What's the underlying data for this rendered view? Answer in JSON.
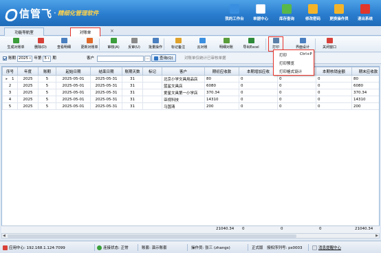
{
  "app": {
    "brand": "信管飞",
    "subtitle": "精细化管理软件",
    "separator": "·"
  },
  "topnav": [
    {
      "label": "我的工作台",
      "icon": "monitor-icon",
      "color": "#3b8fe0"
    },
    {
      "label": "单据中心",
      "icon": "document-list-icon",
      "color": "#ffffff"
    },
    {
      "label": "库存查询",
      "icon": "box-icon",
      "color": "#59b84a"
    },
    {
      "label": "修改密码",
      "icon": "key-icon",
      "color": "#f4b42a"
    },
    {
      "label": "更换操作员",
      "icon": "user-icon",
      "color": "#f4b42a"
    },
    {
      "label": "退出系统",
      "icon": "power-icon",
      "color": "#e0362c"
    }
  ],
  "tabs": {
    "nav": "功能导航室",
    "active": "对账单",
    "close": "×"
  },
  "toolbar": [
    {
      "label": "生成对账单",
      "icon": "generate-icon",
      "color": "#3b9d3b"
    },
    {
      "label": "删除(D)",
      "icon": "delete-icon",
      "color": "#d8413a"
    },
    {
      "label": "查看明细",
      "icon": "detail-icon",
      "color": "#4a7fc0"
    },
    {
      "label": "更新对账单",
      "icon": "refresh-icon",
      "color": "#e06a2a"
    },
    {
      "label": "审核(A)",
      "icon": "approve-icon",
      "color": "#3b9d3b"
    },
    {
      "label": "反审(U)",
      "icon": "unapprove-icon",
      "color": "#8a8a8a"
    },
    {
      "label": "批量操作",
      "icon": "batch-icon",
      "color": "#4a7fc0"
    },
    {
      "label": "标记备注",
      "icon": "mark-icon",
      "color": "#e0a22a"
    },
    {
      "label": "云对账",
      "icon": "cloud-icon",
      "color": "#3b8fe0"
    },
    {
      "label": "明细对账",
      "icon": "reconcile-icon",
      "color": "#5a9d3b"
    },
    {
      "label": "导出Excel",
      "icon": "excel-icon",
      "color": "#2e8b3a"
    },
    {
      "label": "打印",
      "icon": "printer-icon",
      "color": "#5a7fa8"
    },
    {
      "label": "界面设计",
      "icon": "design-icon",
      "color": "#4a7fc0"
    },
    {
      "label": "关闭窗口",
      "icon": "close-window-icon",
      "color": "#d8413a"
    }
  ],
  "filter": {
    "period_label": "账期",
    "year": "2025",
    "year_label": "年第",
    "period": "5",
    "period_suffix": "期",
    "customer_label": "客户",
    "customer_value": "",
    "query_label": "查询(Q)",
    "hint": "对账单仅统计已审核单据",
    "ellipsis": "..."
  },
  "table": {
    "columns": [
      "序号",
      "年度",
      "账期",
      "起始日期",
      "结束日期",
      "账期天数",
      "标记",
      "客户",
      "期初应收款",
      "本期增加应收",
      "本期减少应收",
      "本期核销金额",
      "期末应收款"
    ],
    "rows": [
      [
        "1",
        "2025",
        "5",
        "2025-05-01",
        "2025-05-31",
        "31",
        "",
        "北京小学文具用品店",
        "80",
        "0",
        "0",
        "0",
        "80"
      ],
      [
        "2",
        "2025",
        "5",
        "2025-05-01",
        "2025-05-31",
        "31",
        "",
        "蓝鲨文具店",
        "6080",
        "0",
        "0",
        "0",
        "6080"
      ],
      [
        "3",
        "2025",
        "5",
        "2025-05-01",
        "2025-05-31",
        "31",
        "",
        "爱星文具第一小学店",
        "370.34",
        "0",
        "0",
        "0",
        "370.34"
      ],
      [
        "4",
        "2025",
        "5",
        "2025-05-01",
        "2025-05-31",
        "31",
        "",
        "亚视科技",
        "14310",
        "0",
        "0",
        "0",
        "14310"
      ],
      [
        "5",
        "2025",
        "5",
        "2025-05-01",
        "2025-05-31",
        "31",
        "",
        "马国清",
        "200",
        "0",
        "0",
        "0",
        "200"
      ]
    ],
    "totals": {
      "opening": "21040.34",
      "increase": "0",
      "decrease": "0",
      "writeoff": "0",
      "closing": "21040.34"
    },
    "row_marker": "▸"
  },
  "print_menu": [
    {
      "label": "打印",
      "shortcut": "Ctrl+P"
    },
    {
      "label": "打印预览",
      "shortcut": ""
    },
    {
      "label": "打印格式设计",
      "shortcut": ""
    }
  ],
  "status": {
    "app_center": "应用中心: 192.168.1.124:7099",
    "conn": "连接状态: 正常",
    "account": "账套: 演示账套",
    "operator": "操作员: 张三 (zhangs)",
    "version": "正式版",
    "serial": "授权序列号: ps0003",
    "msg": "消息提醒中心"
  }
}
